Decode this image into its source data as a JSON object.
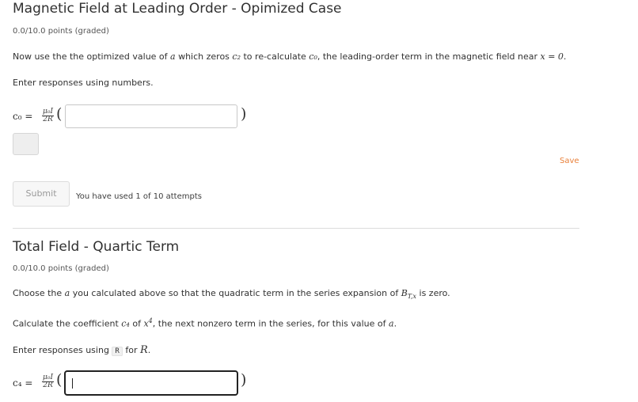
{
  "problem1": {
    "title": "Magnetic Field at Leading Order - Opimized Case",
    "points": "0.0/10.0 points (graded)",
    "intro": {
      "t1": "Now use the the optimized value of ",
      "a": "a",
      "t2": " which zeros ",
      "c2": "c₂",
      "t3": " to re-calculate ",
      "c0": "c₀",
      "t4": ", the leading-order term in the magnetic field near ",
      "eq": "x = 0."
    },
    "instructions": "Enter responses using numbers.",
    "formula": {
      "var": "c₀ =",
      "num": "μ₀I",
      "den": "2R",
      "open": "(",
      "close": ")"
    },
    "input_value": "",
    "save_label": "Save",
    "submit_label": "Submit",
    "attempts_text": "You have used 1 of 10 attempts"
  },
  "problem2": {
    "title": "Total Field - Quartic Term",
    "points": "0.0/10.0 points (graded)",
    "line1": {
      "t1": "Choose the ",
      "a": "a",
      "t2": " you calculated above so that the quadratic term in the series expansion of ",
      "b": "B",
      "sub": "T,x",
      "t3": " is zero."
    },
    "line2": {
      "t1": "Calculate the coefficient ",
      "c4": "c₄",
      "t2": " of ",
      "x": "x",
      "pow": "4",
      "t3": ", the next nonzero term in the series, for this value of ",
      "a": "a",
      "t4": "."
    },
    "line3": {
      "t1": "Enter responses using ",
      "code": "R",
      "t2": " for ",
      "r": "R",
      "t3": "."
    },
    "formula": {
      "var": "c₄ =",
      "num": "μ₀I",
      "den": "2R",
      "open": "(",
      "close": ")"
    },
    "input_value": ""
  }
}
